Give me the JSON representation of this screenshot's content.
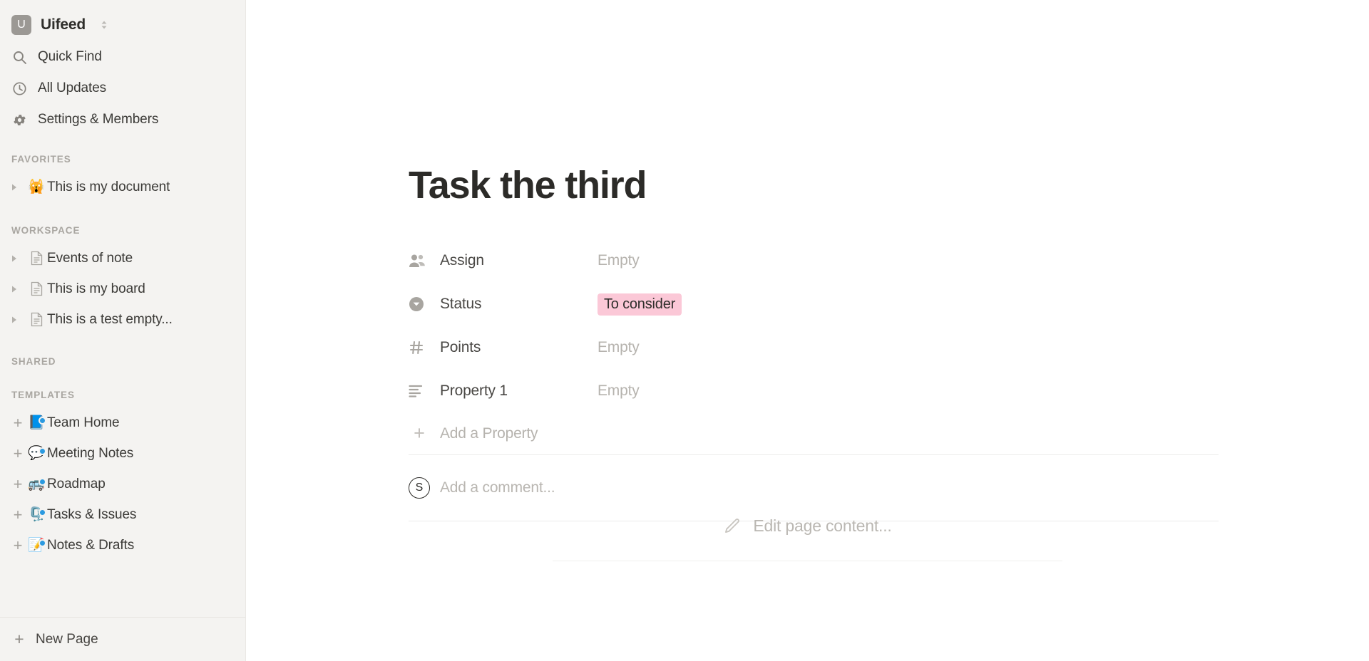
{
  "sidebar": {
    "workspace": {
      "badge_letter": "U",
      "name": "Uifeed",
      "switch_icon": "chevron-up-down-icon"
    },
    "nav": [
      {
        "label": "Quick Find",
        "icon": "search-icon"
      },
      {
        "label": "All Updates",
        "icon": "clock-icon"
      },
      {
        "label": "Settings & Members",
        "icon": "gear-icon"
      }
    ],
    "sections": {
      "favorites_title": "FAVORITES",
      "workspace_title": "WORKSPACE",
      "shared_title": "SHARED",
      "templates_title": "TEMPLATES"
    },
    "favorites": [
      {
        "label": "This is my document",
        "emoji": "🙀",
        "icon": "disclosure-triangle-icon"
      }
    ],
    "workspace_pages": [
      {
        "label": "Events of note",
        "icon": "page-icon"
      },
      {
        "label": "This is my board",
        "icon": "page-icon"
      },
      {
        "label": "This is a test empty...",
        "icon": "page-icon"
      }
    ],
    "templates": [
      {
        "label": "Team Home",
        "emoji": "📘"
      },
      {
        "label": "Meeting Notes",
        "emoji": "💬"
      },
      {
        "label": "Roadmap",
        "emoji": "🚌"
      },
      {
        "label": "Tasks & Issues",
        "emoji": "🗜️"
      },
      {
        "label": "Notes & Drafts",
        "emoji": "📝"
      }
    ],
    "footer": {
      "label": "New Page",
      "icon": "plus-icon"
    }
  },
  "main": {
    "title": "Task the third",
    "properties": [
      {
        "name": "Assign",
        "icon": "people-icon",
        "value": "Empty",
        "type": "text"
      },
      {
        "name": "Status",
        "icon": "status-circle-icon",
        "value": "To consider",
        "type": "badge",
        "badge_color": "#fbc8d7"
      },
      {
        "name": "Points",
        "icon": "hash-icon",
        "value": "Empty",
        "type": "text"
      },
      {
        "name": "Property 1",
        "icon": "text-lines-icon",
        "value": "Empty",
        "type": "text"
      }
    ],
    "add_property_label": "Add a Property",
    "comment": {
      "avatar_letter": "S",
      "placeholder": "Add a comment..."
    },
    "edit_page_label": "Edit page content...",
    "edit_page_icon": "pencil-icon"
  }
}
